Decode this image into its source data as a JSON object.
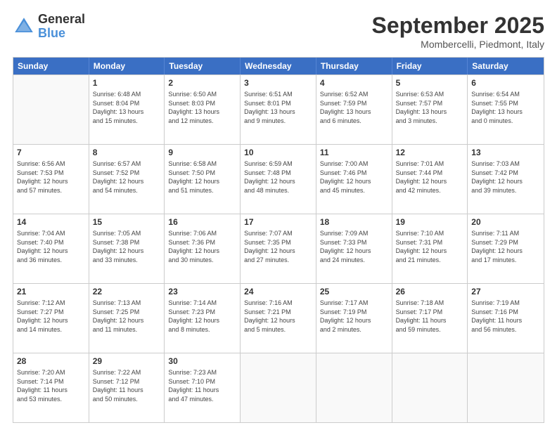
{
  "logo": {
    "general": "General",
    "blue": "Blue"
  },
  "title": "September 2025",
  "subtitle": "Mombercelli, Piedmont, Italy",
  "days": [
    "Sunday",
    "Monday",
    "Tuesday",
    "Wednesday",
    "Thursday",
    "Friday",
    "Saturday"
  ],
  "rows": [
    [
      {
        "day": "",
        "info": ""
      },
      {
        "day": "1",
        "info": "Sunrise: 6:48 AM\nSunset: 8:04 PM\nDaylight: 13 hours\nand 15 minutes."
      },
      {
        "day": "2",
        "info": "Sunrise: 6:50 AM\nSunset: 8:03 PM\nDaylight: 13 hours\nand 12 minutes."
      },
      {
        "day": "3",
        "info": "Sunrise: 6:51 AM\nSunset: 8:01 PM\nDaylight: 13 hours\nand 9 minutes."
      },
      {
        "day": "4",
        "info": "Sunrise: 6:52 AM\nSunset: 7:59 PM\nDaylight: 13 hours\nand 6 minutes."
      },
      {
        "day": "5",
        "info": "Sunrise: 6:53 AM\nSunset: 7:57 PM\nDaylight: 13 hours\nand 3 minutes."
      },
      {
        "day": "6",
        "info": "Sunrise: 6:54 AM\nSunset: 7:55 PM\nDaylight: 13 hours\nand 0 minutes."
      }
    ],
    [
      {
        "day": "7",
        "info": "Sunrise: 6:56 AM\nSunset: 7:53 PM\nDaylight: 12 hours\nand 57 minutes."
      },
      {
        "day": "8",
        "info": "Sunrise: 6:57 AM\nSunset: 7:52 PM\nDaylight: 12 hours\nand 54 minutes."
      },
      {
        "day": "9",
        "info": "Sunrise: 6:58 AM\nSunset: 7:50 PM\nDaylight: 12 hours\nand 51 minutes."
      },
      {
        "day": "10",
        "info": "Sunrise: 6:59 AM\nSunset: 7:48 PM\nDaylight: 12 hours\nand 48 minutes."
      },
      {
        "day": "11",
        "info": "Sunrise: 7:00 AM\nSunset: 7:46 PM\nDaylight: 12 hours\nand 45 minutes."
      },
      {
        "day": "12",
        "info": "Sunrise: 7:01 AM\nSunset: 7:44 PM\nDaylight: 12 hours\nand 42 minutes."
      },
      {
        "day": "13",
        "info": "Sunrise: 7:03 AM\nSunset: 7:42 PM\nDaylight: 12 hours\nand 39 minutes."
      }
    ],
    [
      {
        "day": "14",
        "info": "Sunrise: 7:04 AM\nSunset: 7:40 PM\nDaylight: 12 hours\nand 36 minutes."
      },
      {
        "day": "15",
        "info": "Sunrise: 7:05 AM\nSunset: 7:38 PM\nDaylight: 12 hours\nand 33 minutes."
      },
      {
        "day": "16",
        "info": "Sunrise: 7:06 AM\nSunset: 7:36 PM\nDaylight: 12 hours\nand 30 minutes."
      },
      {
        "day": "17",
        "info": "Sunrise: 7:07 AM\nSunset: 7:35 PM\nDaylight: 12 hours\nand 27 minutes."
      },
      {
        "day": "18",
        "info": "Sunrise: 7:09 AM\nSunset: 7:33 PM\nDaylight: 12 hours\nand 24 minutes."
      },
      {
        "day": "19",
        "info": "Sunrise: 7:10 AM\nSunset: 7:31 PM\nDaylight: 12 hours\nand 21 minutes."
      },
      {
        "day": "20",
        "info": "Sunrise: 7:11 AM\nSunset: 7:29 PM\nDaylight: 12 hours\nand 17 minutes."
      }
    ],
    [
      {
        "day": "21",
        "info": "Sunrise: 7:12 AM\nSunset: 7:27 PM\nDaylight: 12 hours\nand 14 minutes."
      },
      {
        "day": "22",
        "info": "Sunrise: 7:13 AM\nSunset: 7:25 PM\nDaylight: 12 hours\nand 11 minutes."
      },
      {
        "day": "23",
        "info": "Sunrise: 7:14 AM\nSunset: 7:23 PM\nDaylight: 12 hours\nand 8 minutes."
      },
      {
        "day": "24",
        "info": "Sunrise: 7:16 AM\nSunset: 7:21 PM\nDaylight: 12 hours\nand 5 minutes."
      },
      {
        "day": "25",
        "info": "Sunrise: 7:17 AM\nSunset: 7:19 PM\nDaylight: 12 hours\nand 2 minutes."
      },
      {
        "day": "26",
        "info": "Sunrise: 7:18 AM\nSunset: 7:17 PM\nDaylight: 11 hours\nand 59 minutes."
      },
      {
        "day": "27",
        "info": "Sunrise: 7:19 AM\nSunset: 7:16 PM\nDaylight: 11 hours\nand 56 minutes."
      }
    ],
    [
      {
        "day": "28",
        "info": "Sunrise: 7:20 AM\nSunset: 7:14 PM\nDaylight: 11 hours\nand 53 minutes."
      },
      {
        "day": "29",
        "info": "Sunrise: 7:22 AM\nSunset: 7:12 PM\nDaylight: 11 hours\nand 50 minutes."
      },
      {
        "day": "30",
        "info": "Sunrise: 7:23 AM\nSunset: 7:10 PM\nDaylight: 11 hours\nand 47 minutes."
      },
      {
        "day": "",
        "info": ""
      },
      {
        "day": "",
        "info": ""
      },
      {
        "day": "",
        "info": ""
      },
      {
        "day": "",
        "info": ""
      }
    ]
  ]
}
